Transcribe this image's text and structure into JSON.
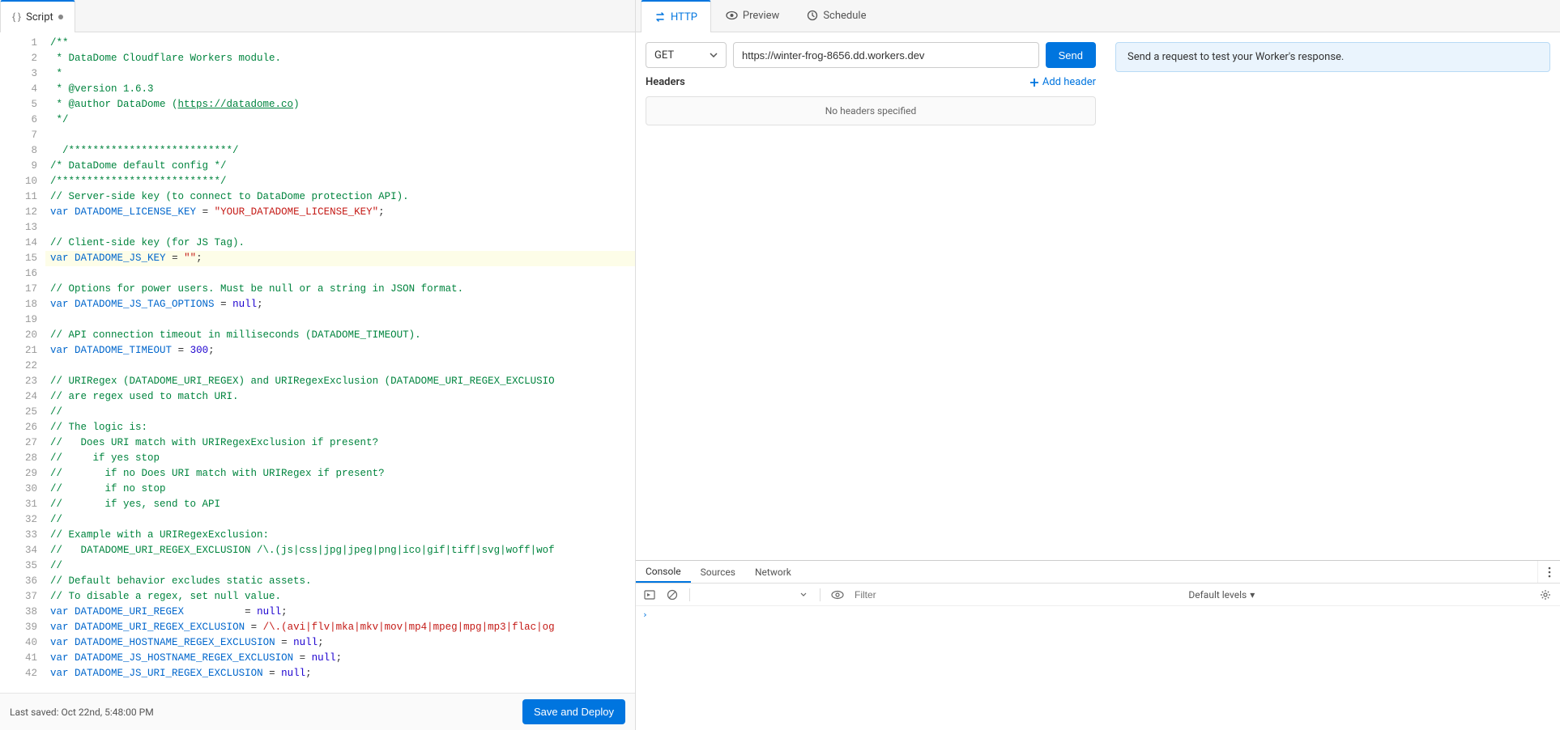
{
  "left": {
    "tab_label": "Script",
    "last_saved": "Last saved: Oct 22nd, 5:48:00 PM",
    "save_button": "Save and Deploy"
  },
  "code": {
    "highlighted_line": 15,
    "lines": [
      {
        "n": 1,
        "seg": [
          {
            "t": "/**",
            "c": "comment"
          }
        ]
      },
      {
        "n": 2,
        "seg": [
          {
            "t": " * DataDome Cloudflare Workers module.",
            "c": "comment"
          }
        ]
      },
      {
        "n": 3,
        "seg": [
          {
            "t": " *",
            "c": "comment"
          }
        ]
      },
      {
        "n": 4,
        "seg": [
          {
            "t": " * @version 1.6.3",
            "c": "comment"
          }
        ]
      },
      {
        "n": 5,
        "seg": [
          {
            "t": " * @author DataDome (",
            "c": "comment"
          },
          {
            "t": "https://datadome.co",
            "c": "comment-link"
          },
          {
            "t": ")",
            "c": "comment"
          }
        ]
      },
      {
        "n": 6,
        "seg": [
          {
            "t": " */",
            "c": "comment"
          }
        ]
      },
      {
        "n": 7,
        "seg": []
      },
      {
        "n": 8,
        "seg": [
          {
            "t": "  ",
            "c": "plain"
          },
          {
            "t": "/***************************/",
            "c": "comment"
          }
        ]
      },
      {
        "n": 9,
        "seg": [
          {
            "t": "/* DataDome default config */",
            "c": "comment"
          }
        ]
      },
      {
        "n": 10,
        "seg": [
          {
            "t": "/***************************/",
            "c": "comment"
          }
        ]
      },
      {
        "n": 11,
        "seg": [
          {
            "t": "// Server-side key (to connect to DataDome protection API).",
            "c": "comment"
          }
        ]
      },
      {
        "n": 12,
        "seg": [
          {
            "t": "var",
            "c": "kw"
          },
          {
            "t": " ",
            "c": "plain"
          },
          {
            "t": "DATADOME_LICENSE_KEY",
            "c": "var"
          },
          {
            "t": " = ",
            "c": "plain"
          },
          {
            "t": "\"YOUR_DATADOME_LICENSE_KEY\"",
            "c": "str"
          },
          {
            "t": ";",
            "c": "plain"
          }
        ]
      },
      {
        "n": 13,
        "seg": []
      },
      {
        "n": 14,
        "seg": [
          {
            "t": "// Client-side key (for JS Tag).",
            "c": "comment"
          }
        ]
      },
      {
        "n": 15,
        "seg": [
          {
            "t": "var",
            "c": "kw"
          },
          {
            "t": " ",
            "c": "plain"
          },
          {
            "t": "DATADOME_JS_KEY",
            "c": "var"
          },
          {
            "t": " = ",
            "c": "plain"
          },
          {
            "t": "\"\"",
            "c": "str"
          },
          {
            "t": ";",
            "c": "plain"
          }
        ]
      },
      {
        "n": 16,
        "seg": []
      },
      {
        "n": 17,
        "seg": [
          {
            "t": "// Options for power users. Must be null or a string in JSON format.",
            "c": "comment"
          }
        ]
      },
      {
        "n": 18,
        "seg": [
          {
            "t": "var",
            "c": "kw"
          },
          {
            "t": " ",
            "c": "plain"
          },
          {
            "t": "DATADOME_JS_TAG_OPTIONS",
            "c": "var"
          },
          {
            "t": " = ",
            "c": "plain"
          },
          {
            "t": "null",
            "c": "null"
          },
          {
            "t": ";",
            "c": "plain"
          }
        ]
      },
      {
        "n": 19,
        "seg": []
      },
      {
        "n": 20,
        "seg": [
          {
            "t": "// API connection timeout in milliseconds (DATADOME_TIMEOUT).",
            "c": "comment"
          }
        ]
      },
      {
        "n": 21,
        "seg": [
          {
            "t": "var",
            "c": "kw"
          },
          {
            "t": " ",
            "c": "plain"
          },
          {
            "t": "DATADOME_TIMEOUT",
            "c": "var"
          },
          {
            "t": " = ",
            "c": "plain"
          },
          {
            "t": "300",
            "c": "num"
          },
          {
            "t": ";",
            "c": "plain"
          }
        ]
      },
      {
        "n": 22,
        "seg": []
      },
      {
        "n": 23,
        "seg": [
          {
            "t": "// URIRegex (DATADOME_URI_REGEX) and URIRegexExclusion (DATADOME_URI_REGEX_EXCLUSIO",
            "c": "comment"
          }
        ]
      },
      {
        "n": 24,
        "seg": [
          {
            "t": "// are regex used to match URI.",
            "c": "comment"
          }
        ]
      },
      {
        "n": 25,
        "seg": [
          {
            "t": "//",
            "c": "comment"
          }
        ]
      },
      {
        "n": 26,
        "seg": [
          {
            "t": "// The logic is:",
            "c": "comment"
          }
        ]
      },
      {
        "n": 27,
        "seg": [
          {
            "t": "//   Does URI match with URIRegexExclusion if present?",
            "c": "comment"
          }
        ]
      },
      {
        "n": 28,
        "seg": [
          {
            "t": "//     if yes stop",
            "c": "comment"
          }
        ]
      },
      {
        "n": 29,
        "seg": [
          {
            "t": "//       if no Does URI match with URIRegex if present?",
            "c": "comment"
          }
        ]
      },
      {
        "n": 30,
        "seg": [
          {
            "t": "//       if no stop",
            "c": "comment"
          }
        ]
      },
      {
        "n": 31,
        "seg": [
          {
            "t": "//       if yes, send to API",
            "c": "comment"
          }
        ]
      },
      {
        "n": 32,
        "seg": [
          {
            "t": "//",
            "c": "comment"
          }
        ]
      },
      {
        "n": 33,
        "seg": [
          {
            "t": "// Example with a URIRegexExclusion:",
            "c": "comment"
          }
        ]
      },
      {
        "n": 34,
        "seg": [
          {
            "t": "//   DATADOME_URI_REGEX_EXCLUSION /\\.(js|css|jpg|jpeg|png|ico|gif|tiff|svg|woff|wof",
            "c": "comment"
          }
        ]
      },
      {
        "n": 35,
        "seg": [
          {
            "t": "//",
            "c": "comment"
          }
        ]
      },
      {
        "n": 36,
        "seg": [
          {
            "t": "// Default behavior excludes static assets.",
            "c": "comment"
          }
        ]
      },
      {
        "n": 37,
        "seg": [
          {
            "t": "// To disable a regex, set null value.",
            "c": "comment"
          }
        ]
      },
      {
        "n": 38,
        "seg": [
          {
            "t": "var",
            "c": "kw"
          },
          {
            "t": " ",
            "c": "plain"
          },
          {
            "t": "DATADOME_URI_REGEX",
            "c": "var"
          },
          {
            "t": "          = ",
            "c": "plain"
          },
          {
            "t": "null",
            "c": "null"
          },
          {
            "t": ";",
            "c": "plain"
          }
        ]
      },
      {
        "n": 39,
        "seg": [
          {
            "t": "var",
            "c": "kw"
          },
          {
            "t": " ",
            "c": "plain"
          },
          {
            "t": "DATADOME_URI_REGEX_EXCLUSION",
            "c": "var"
          },
          {
            "t": " = ",
            "c": "plain"
          },
          {
            "t": "/\\.(avi|flv|mka|mkv|mov|mp4|mpeg|mpg|mp3|flac|og",
            "c": "str"
          }
        ]
      },
      {
        "n": 40,
        "seg": [
          {
            "t": "var",
            "c": "kw"
          },
          {
            "t": " ",
            "c": "plain"
          },
          {
            "t": "DATADOME_HOSTNAME_REGEX_EXCLUSION",
            "c": "var"
          },
          {
            "t": " = ",
            "c": "plain"
          },
          {
            "t": "null",
            "c": "null"
          },
          {
            "t": ";",
            "c": "plain"
          }
        ]
      },
      {
        "n": 41,
        "seg": [
          {
            "t": "var",
            "c": "kw"
          },
          {
            "t": " ",
            "c": "plain"
          },
          {
            "t": "DATADOME_JS_HOSTNAME_REGEX_EXCLUSION",
            "c": "var"
          },
          {
            "t": " = ",
            "c": "plain"
          },
          {
            "t": "null",
            "c": "null"
          },
          {
            "t": ";",
            "c": "plain"
          }
        ]
      },
      {
        "n": 42,
        "seg": [
          {
            "t": "var",
            "c": "kw"
          },
          {
            "t": " ",
            "c": "plain"
          },
          {
            "t": "DATADOME_JS_URI_REGEX_EXCLUSION",
            "c": "var"
          },
          {
            "t": " = ",
            "c": "plain"
          },
          {
            "t": "null",
            "c": "null"
          },
          {
            "t": ";",
            "c": "plain"
          }
        ]
      }
    ]
  },
  "right": {
    "tabs": [
      {
        "id": "http",
        "label": "HTTP",
        "icon": "swap",
        "active": true
      },
      {
        "id": "preview",
        "label": "Preview",
        "icon": "eye",
        "active": false
      },
      {
        "id": "schedule",
        "label": "Schedule",
        "icon": "clock",
        "active": false
      }
    ],
    "method": "GET",
    "url": "https://winter-frog-8656.dd.workers.dev",
    "send": "Send",
    "headers_label": "Headers",
    "add_header": "Add header",
    "no_headers": "No headers specified",
    "info": "Send a request to test your Worker's response."
  },
  "devtools": {
    "tabs": [
      "Console",
      "Sources",
      "Network"
    ],
    "active_tab": "Console",
    "filter_placeholder": "Filter",
    "levels": "Default levels"
  }
}
